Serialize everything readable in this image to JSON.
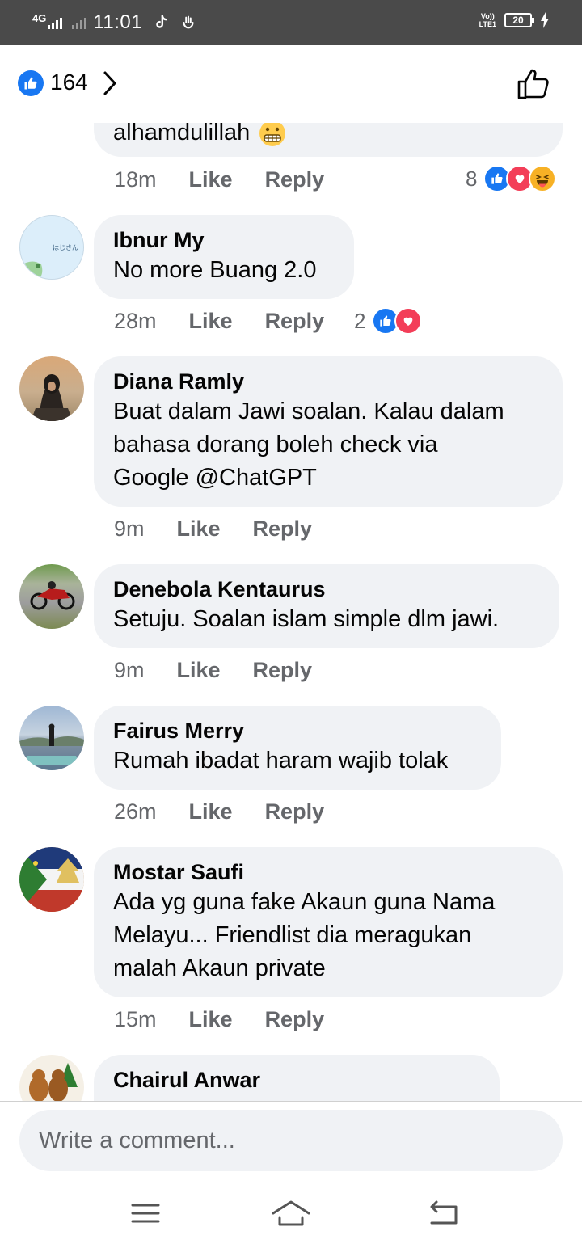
{
  "status_bar": {
    "network": "4G",
    "time": "11:01",
    "volte_top": "Vo))",
    "volte_bottom": "LTE1",
    "battery": "20"
  },
  "header": {
    "reaction_count": "164"
  },
  "comments": [
    {
      "text": "alhamdulillah",
      "time": "18m",
      "like": "Like",
      "reply": "Reply",
      "reaction_count": "8",
      "reactions": [
        "like-icon",
        "love-icon",
        "haha-icon"
      ]
    },
    {
      "name": "Ibnur My",
      "text": "No more Buang 2.0",
      "avatar_text": "はじさん",
      "time": "28m",
      "like": "Like",
      "reply": "Reply",
      "reaction_count": "2",
      "reactions": [
        "like-icon",
        "love-icon"
      ]
    },
    {
      "name": "Diana Ramly",
      "lines": [
        "Buat dalam Jawi soalan. Kalau dalam",
        "bahasa dorang boleh check via",
        "Google @ChatGPT"
      ],
      "time": "9m",
      "like": "Like",
      "reply": "Reply"
    },
    {
      "name": "Denebola Kentaurus",
      "text": "Setuju. Soalan islam simple dlm jawi.",
      "time": "9m",
      "like": "Like",
      "reply": "Reply"
    },
    {
      "name": "Fairus Merry",
      "text": "Rumah ibadat haram wajib tolak",
      "time": "26m",
      "like": "Like",
      "reply": "Reply"
    },
    {
      "name": "Mostar Saufi",
      "lines": [
        "Ada yg guna fake Akaun guna Nama",
        "Melayu... Friendlist dia meragukan",
        "malah Akaun private"
      ],
      "time": "15m",
      "like": "Like",
      "reply": "Reply"
    },
    {
      "name": "Chairul Anwar"
    }
  ],
  "composer": {
    "placeholder": "Write a comment..."
  },
  "colors": {
    "facebook_blue": "#1877f2",
    "love_red": "#f33e58",
    "haha_yellow": "#f7b125",
    "bubble_bg": "#f0f2f5",
    "meta_gray": "#65676b"
  }
}
